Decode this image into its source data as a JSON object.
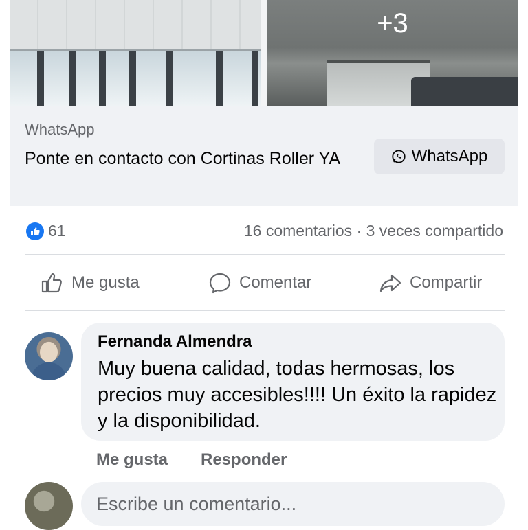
{
  "gallery": {
    "more_photos_label": "+3"
  },
  "ad": {
    "source": "WhatsApp",
    "title": "Ponte en contacto con Cortinas Roller YA",
    "cta_label": "WhatsApp",
    "cta_icon": "whatsapp-icon"
  },
  "stats": {
    "reaction_icon": "like-icon",
    "reaction_count": "61",
    "summary": "16 comentarios · 3 veces compartido"
  },
  "actions": {
    "like_label": "Me gusta",
    "comment_label": "Comentar",
    "share_label": "Compartir"
  },
  "comment": {
    "author": "Fernanda Almendra",
    "text": "Muy buena calidad, todas hermosas, los precios muy accesibles!!!! Un éxito la rapidez y la disponibilidad.",
    "like_label": "Me gusta",
    "reply_label": "Responder"
  },
  "composer": {
    "placeholder": "Escribe un comentario..."
  },
  "colors": {
    "accent": "#1877f2",
    "secondary_text": "#65676b",
    "surface": "#f0f2f5"
  }
}
